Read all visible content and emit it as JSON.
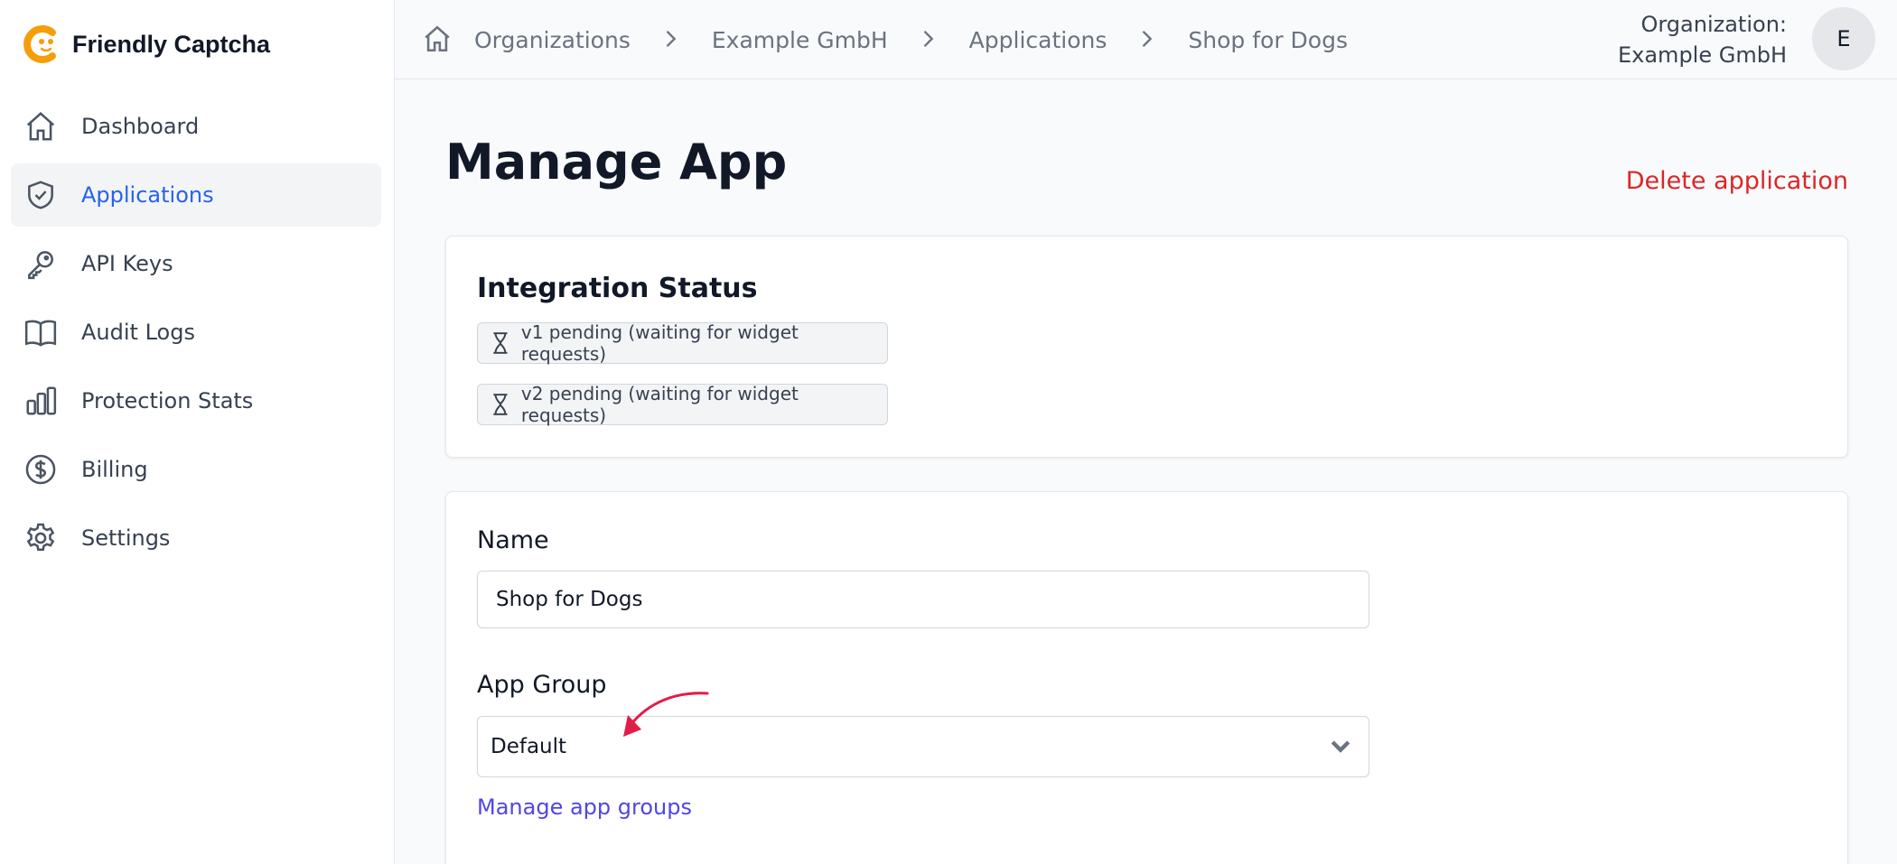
{
  "brand": {
    "name": "Friendly Captcha",
    "color": "#f59e0b"
  },
  "sidebar": {
    "items": [
      {
        "label": "Dashboard",
        "icon": "home-icon",
        "active": false
      },
      {
        "label": "Applications",
        "icon": "shield-check-icon",
        "active": true
      },
      {
        "label": "API Keys",
        "icon": "key-icon",
        "active": false
      },
      {
        "label": "Audit Logs",
        "icon": "book-icon",
        "active": false
      },
      {
        "label": "Protection Stats",
        "icon": "bar-chart-icon",
        "active": false
      },
      {
        "label": "Billing",
        "icon": "dollar-circle-icon",
        "active": false
      },
      {
        "label": "Settings",
        "icon": "gear-icon",
        "active": false
      }
    ]
  },
  "header": {
    "breadcrumb": [
      "Organizations",
      "Example GmbH",
      "Applications",
      "Shop for Dogs"
    ],
    "org_label": "Organization:",
    "org_name": "Example GmbH",
    "avatar_initial": "E"
  },
  "main": {
    "title": "Manage App",
    "delete_label": "Delete application",
    "status": {
      "title": "Integration Status",
      "badges": [
        "v1 pending (waiting for widget requests)",
        "v2 pending (waiting for widget requests)"
      ]
    },
    "form": {
      "name_label": "Name",
      "name_value": "Shop for Dogs",
      "group_label": "App Group",
      "group_value": "Default",
      "manage_groups_label": "Manage app groups"
    }
  },
  "colors": {
    "accent": "#2563eb",
    "danger": "#dc2626",
    "link": "#4f46e5",
    "annotation": "#e11d48"
  }
}
